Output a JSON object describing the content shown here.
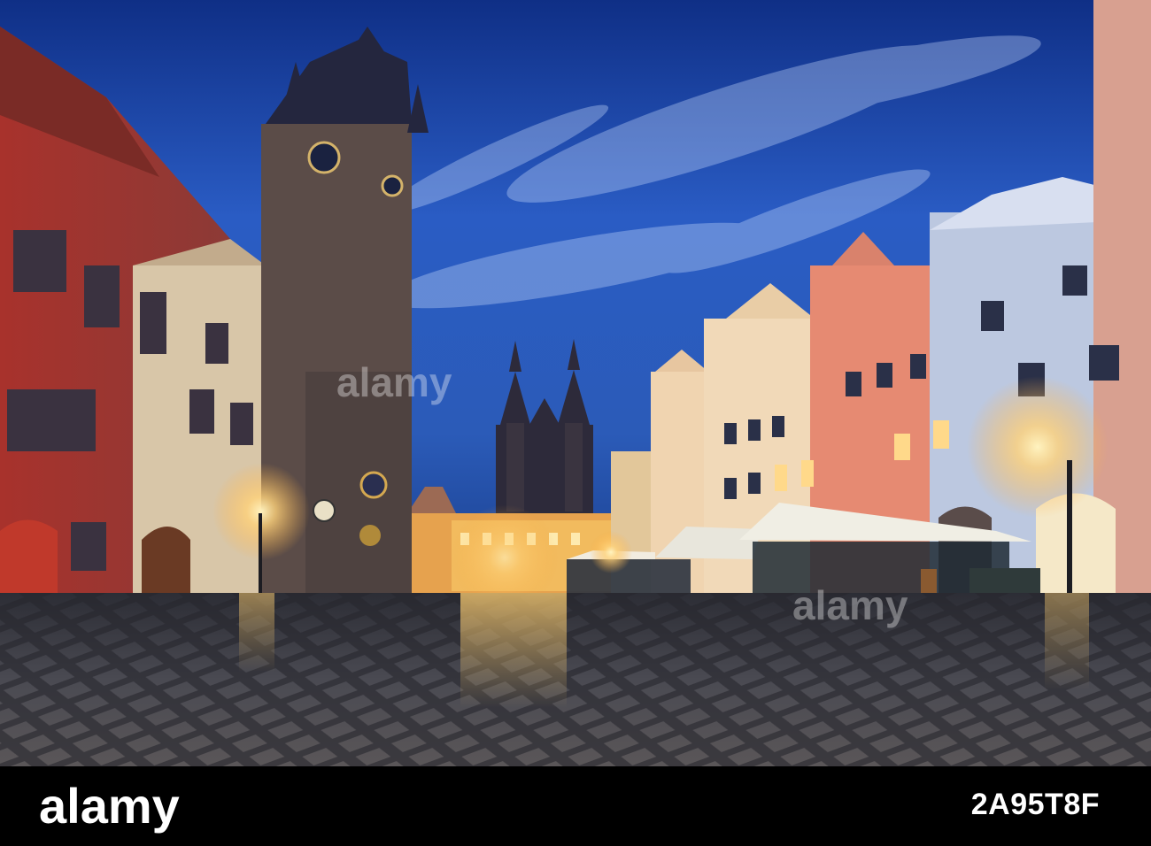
{
  "photo": {
    "subject": "Old Town Square at dusk",
    "colors": {
      "sky_top": "#123a96",
      "sky_mid": "#2c62c8",
      "sky_low": "#1b3f8c",
      "lamp_glow": "#ffd27a",
      "plaza": "#3a3a40"
    }
  },
  "watermark": {
    "text": "alamy",
    "icon": "alamy-watermark-logo"
  },
  "footer": {
    "logo_text": "alamy",
    "image_id": "2A95T8F"
  }
}
